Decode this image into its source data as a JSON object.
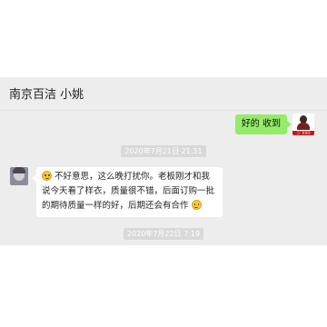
{
  "header": {
    "title": "南京百洁 小姚"
  },
  "messages": {
    "me": {
      "text": "好的 收到",
      "avatar_tag": "工厂直营店"
    },
    "timestamp1": "2020年7月21日 21:31",
    "other": {
      "text_part1": "不好意思，这么晚打扰你。老板刚才和我说今天看了样衣，质量很不错，后面订购一批的期待质量一样的好，后期还会有合作"
    },
    "timestamp2": "2020年7月22日 7:19"
  },
  "icons": {
    "emoji": "smile-emoji-icon"
  },
  "colors": {
    "chat_bg": "#ededed",
    "my_bubble": "#95ec69",
    "other_bubble": "#ffffff"
  }
}
